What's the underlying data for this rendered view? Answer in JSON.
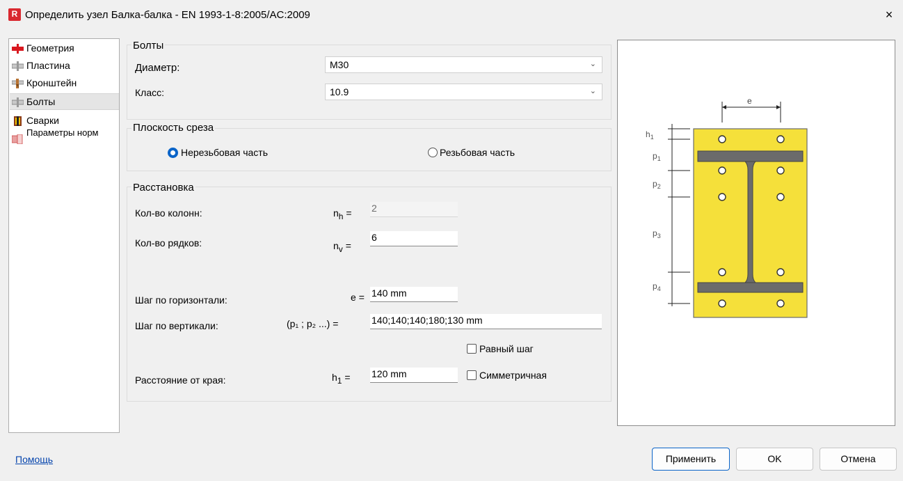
{
  "window": {
    "title": "Определить узел Балка-балка - EN 1993-1-8:2005/AC:2009",
    "app_badge": "R",
    "close_label": "×"
  },
  "nav": {
    "items": [
      {
        "label": "Геометрия"
      },
      {
        "label": "Пластина"
      },
      {
        "label": "Кронштейн"
      },
      {
        "label": "Болты"
      },
      {
        "label": "Сварки"
      },
      {
        "label": "Параметры норм"
      }
    ]
  },
  "bolts": {
    "title": "Болты",
    "diameter_label": "Диаметр:",
    "diameter_value": "M30",
    "class_label": "Класс:",
    "class_value": "10.9"
  },
  "shear": {
    "title": "Плоскость среза",
    "option_unthreaded": "Нерезьбовая часть",
    "option_threaded": "Резьбовая часть",
    "selected": "unthreaded"
  },
  "layout": {
    "title": "Расстановка",
    "cols_label": "Кол-во колонн:",
    "cols_symbol": "n",
    "cols_sub": "h",
    "cols_value": "2",
    "rows_label": "Кол-во рядков:",
    "rows_symbol": "n",
    "rows_sub": "v",
    "rows_value": "6",
    "hstep_label": "Шаг по горизонтали:",
    "hstep_symbol": "e",
    "hstep_value": "140 mm",
    "vstep_label": "Шаг по вертикали:",
    "vstep_symbol": "(p₁ ; p₂ ...)",
    "vstep_value": "140;140;140;180;130 mm",
    "equal_step_label": "Равный шаг",
    "edge_label": "Расстояние от края:",
    "edge_symbol": "h",
    "edge_sub": "1",
    "edge_value": "120 mm",
    "symmetric_label": "Симметричная",
    "eq": "="
  },
  "diagram": {
    "plate_color": "#f5e03a",
    "beam_color": "#6b6b6b",
    "labels": {
      "e": "e",
      "h1": "h",
      "h1_sub": "1",
      "p1": "p",
      "p1_sub": "1",
      "p2": "p",
      "p2_sub": "2",
      "p3": "p",
      "p3_sub": "3",
      "p4": "p",
      "p4_sub": "4"
    }
  },
  "footer": {
    "help": "Помощь",
    "apply": "Применить",
    "ok": "OK",
    "cancel": "Отмена"
  }
}
